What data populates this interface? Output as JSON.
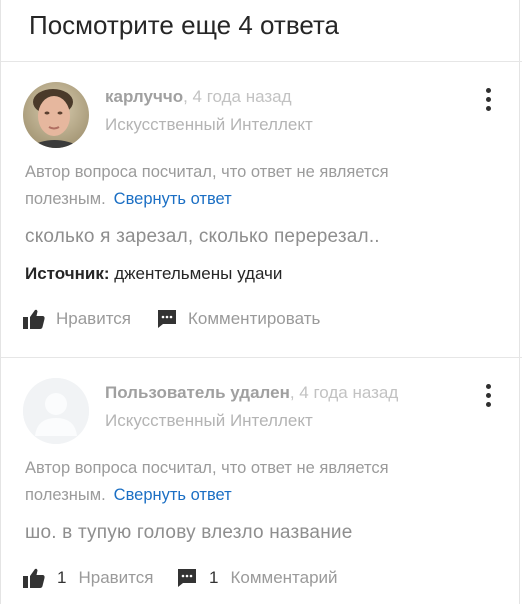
{
  "header": {
    "title": "Посмотрите еще 4 ответа"
  },
  "answers": [
    {
      "author": "карлуччо",
      "time": ", 4 года назад",
      "category": "Искусственный Интеллект",
      "notice_line1": "Автор вопроса посчитал, что ответ не является",
      "notice_line2": "полезным.",
      "collapse_label": "Свернуть ответ",
      "text": "сколько я зарезал, сколько перерезал..",
      "source_label": "Источник:",
      "source_value": " джентельмены удачи",
      "like_label": "Нравится",
      "comment_label": "Комментировать"
    },
    {
      "author": "Пользователь удален",
      "time": ", 4 года назад",
      "category": "Искусственный Интеллект",
      "notice_line1": "Автор вопроса посчитал, что ответ не является",
      "notice_line2": "полезным.",
      "collapse_label": "Свернуть ответ",
      "text": "шо. в тупую голову влезло название",
      "like_count": "1",
      "like_label": "Нравится",
      "comment_count": "1",
      "comment_label": "Комментарий"
    }
  ]
}
